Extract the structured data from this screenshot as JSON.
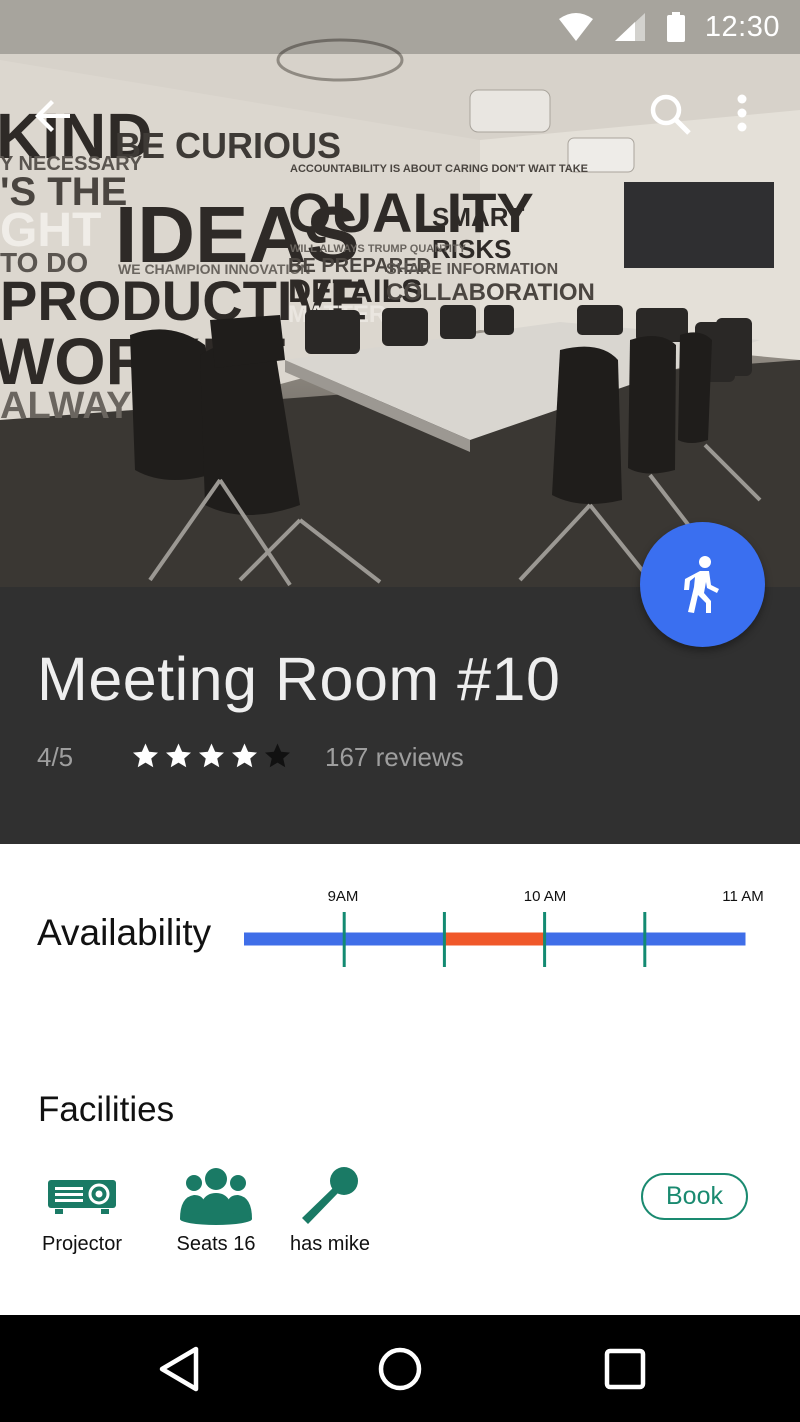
{
  "status_bar": {
    "time": "12:30",
    "icons": [
      "wifi-icon",
      "cell-signal-icon",
      "battery-icon"
    ]
  },
  "app_bar": {
    "icons": [
      "back-arrow-icon",
      "search-icon",
      "more-vert-icon"
    ]
  },
  "hero": {
    "wall_text": [
      "KIND",
      "BE CURIOUS",
      "Y NECESSARY",
      "'S THE",
      "IDEAS",
      "QUALITY",
      "SMART",
      "RISKS",
      "GHT",
      "TO DO",
      "WE CHAMPION INNOVATION",
      "BE PREPARED",
      "SHARE INFORMATION",
      "PRODUCTIVE",
      "DETAILS",
      "COLLABORATION",
      "MATTER",
      "WORKET",
      "ALWAYS",
      "ACCOUNTABILITY IS ABOUT CARING DON'T WAIT TAKE",
      "WILL ALWAYS TRUMP QUANTITY"
    ]
  },
  "room": {
    "title": "Meeting Room #10",
    "rating_text": "4/5",
    "rating_value": 4,
    "rating_max": 5,
    "reviews": "167 reviews"
  },
  "fab": {
    "icon": "walking-person-icon"
  },
  "availability": {
    "label": "Availability",
    "tick_labels": [
      "9AM",
      "10 AM",
      "11 AM"
    ],
    "segments": [
      {
        "state": "free",
        "color": "#3f6ee8"
      },
      {
        "state": "free",
        "color": "#3f6ee8"
      },
      {
        "state": "booked",
        "color": "#f0582a"
      },
      {
        "state": "free",
        "color": "#3f6ee8"
      },
      {
        "state": "free",
        "color": "#3f6ee8"
      }
    ],
    "tick_color": "#138a72"
  },
  "facilities": {
    "title": "Facilities",
    "items": [
      {
        "label": "Projector",
        "icon": "projector-icon"
      },
      {
        "label": "Seats 16",
        "icon": "people-group-icon"
      },
      {
        "label": "has mike",
        "icon": "microphone-icon"
      }
    ],
    "icon_color": "#1a7a65"
  },
  "book_button": {
    "label": "Book",
    "color": "#1a8a70"
  },
  "nav_bar": {
    "buttons": [
      "back-triangle-icon",
      "home-circle-icon",
      "recents-square-icon"
    ]
  },
  "colors": {
    "title_panel_bg": "#303030",
    "fab_bg": "#3a6ff0",
    "accent": "#138a72"
  }
}
